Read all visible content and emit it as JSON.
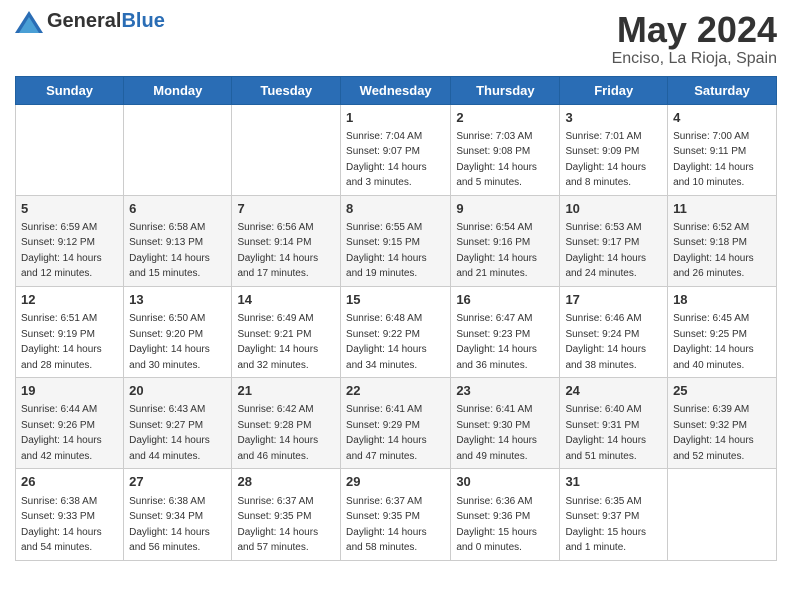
{
  "header": {
    "logo_general": "General",
    "logo_blue": "Blue",
    "month_year": "May 2024",
    "location": "Enciso, La Rioja, Spain"
  },
  "weekdays": [
    "Sunday",
    "Monday",
    "Tuesday",
    "Wednesday",
    "Thursday",
    "Friday",
    "Saturday"
  ],
  "weeks": [
    [
      {
        "day": "",
        "info": ""
      },
      {
        "day": "",
        "info": ""
      },
      {
        "day": "",
        "info": ""
      },
      {
        "day": "1",
        "info": "Sunrise: 7:04 AM\nSunset: 9:07 PM\nDaylight: 14 hours\nand 3 minutes."
      },
      {
        "day": "2",
        "info": "Sunrise: 7:03 AM\nSunset: 9:08 PM\nDaylight: 14 hours\nand 5 minutes."
      },
      {
        "day": "3",
        "info": "Sunrise: 7:01 AM\nSunset: 9:09 PM\nDaylight: 14 hours\nand 8 minutes."
      },
      {
        "day": "4",
        "info": "Sunrise: 7:00 AM\nSunset: 9:11 PM\nDaylight: 14 hours\nand 10 minutes."
      }
    ],
    [
      {
        "day": "5",
        "info": "Sunrise: 6:59 AM\nSunset: 9:12 PM\nDaylight: 14 hours\nand 12 minutes."
      },
      {
        "day": "6",
        "info": "Sunrise: 6:58 AM\nSunset: 9:13 PM\nDaylight: 14 hours\nand 15 minutes."
      },
      {
        "day": "7",
        "info": "Sunrise: 6:56 AM\nSunset: 9:14 PM\nDaylight: 14 hours\nand 17 minutes."
      },
      {
        "day": "8",
        "info": "Sunrise: 6:55 AM\nSunset: 9:15 PM\nDaylight: 14 hours\nand 19 minutes."
      },
      {
        "day": "9",
        "info": "Sunrise: 6:54 AM\nSunset: 9:16 PM\nDaylight: 14 hours\nand 21 minutes."
      },
      {
        "day": "10",
        "info": "Sunrise: 6:53 AM\nSunset: 9:17 PM\nDaylight: 14 hours\nand 24 minutes."
      },
      {
        "day": "11",
        "info": "Sunrise: 6:52 AM\nSunset: 9:18 PM\nDaylight: 14 hours\nand 26 minutes."
      }
    ],
    [
      {
        "day": "12",
        "info": "Sunrise: 6:51 AM\nSunset: 9:19 PM\nDaylight: 14 hours\nand 28 minutes."
      },
      {
        "day": "13",
        "info": "Sunrise: 6:50 AM\nSunset: 9:20 PM\nDaylight: 14 hours\nand 30 minutes."
      },
      {
        "day": "14",
        "info": "Sunrise: 6:49 AM\nSunset: 9:21 PM\nDaylight: 14 hours\nand 32 minutes."
      },
      {
        "day": "15",
        "info": "Sunrise: 6:48 AM\nSunset: 9:22 PM\nDaylight: 14 hours\nand 34 minutes."
      },
      {
        "day": "16",
        "info": "Sunrise: 6:47 AM\nSunset: 9:23 PM\nDaylight: 14 hours\nand 36 minutes."
      },
      {
        "day": "17",
        "info": "Sunrise: 6:46 AM\nSunset: 9:24 PM\nDaylight: 14 hours\nand 38 minutes."
      },
      {
        "day": "18",
        "info": "Sunrise: 6:45 AM\nSunset: 9:25 PM\nDaylight: 14 hours\nand 40 minutes."
      }
    ],
    [
      {
        "day": "19",
        "info": "Sunrise: 6:44 AM\nSunset: 9:26 PM\nDaylight: 14 hours\nand 42 minutes."
      },
      {
        "day": "20",
        "info": "Sunrise: 6:43 AM\nSunset: 9:27 PM\nDaylight: 14 hours\nand 44 minutes."
      },
      {
        "day": "21",
        "info": "Sunrise: 6:42 AM\nSunset: 9:28 PM\nDaylight: 14 hours\nand 46 minutes."
      },
      {
        "day": "22",
        "info": "Sunrise: 6:41 AM\nSunset: 9:29 PM\nDaylight: 14 hours\nand 47 minutes."
      },
      {
        "day": "23",
        "info": "Sunrise: 6:41 AM\nSunset: 9:30 PM\nDaylight: 14 hours\nand 49 minutes."
      },
      {
        "day": "24",
        "info": "Sunrise: 6:40 AM\nSunset: 9:31 PM\nDaylight: 14 hours\nand 51 minutes."
      },
      {
        "day": "25",
        "info": "Sunrise: 6:39 AM\nSunset: 9:32 PM\nDaylight: 14 hours\nand 52 minutes."
      }
    ],
    [
      {
        "day": "26",
        "info": "Sunrise: 6:38 AM\nSunset: 9:33 PM\nDaylight: 14 hours\nand 54 minutes."
      },
      {
        "day": "27",
        "info": "Sunrise: 6:38 AM\nSunset: 9:34 PM\nDaylight: 14 hours\nand 56 minutes."
      },
      {
        "day": "28",
        "info": "Sunrise: 6:37 AM\nSunset: 9:35 PM\nDaylight: 14 hours\nand 57 minutes."
      },
      {
        "day": "29",
        "info": "Sunrise: 6:37 AM\nSunset: 9:35 PM\nDaylight: 14 hours\nand 58 minutes."
      },
      {
        "day": "30",
        "info": "Sunrise: 6:36 AM\nSunset: 9:36 PM\nDaylight: 15 hours\nand 0 minutes."
      },
      {
        "day": "31",
        "info": "Sunrise: 6:35 AM\nSunset: 9:37 PM\nDaylight: 15 hours\nand 1 minute."
      },
      {
        "day": "",
        "info": ""
      }
    ]
  ]
}
